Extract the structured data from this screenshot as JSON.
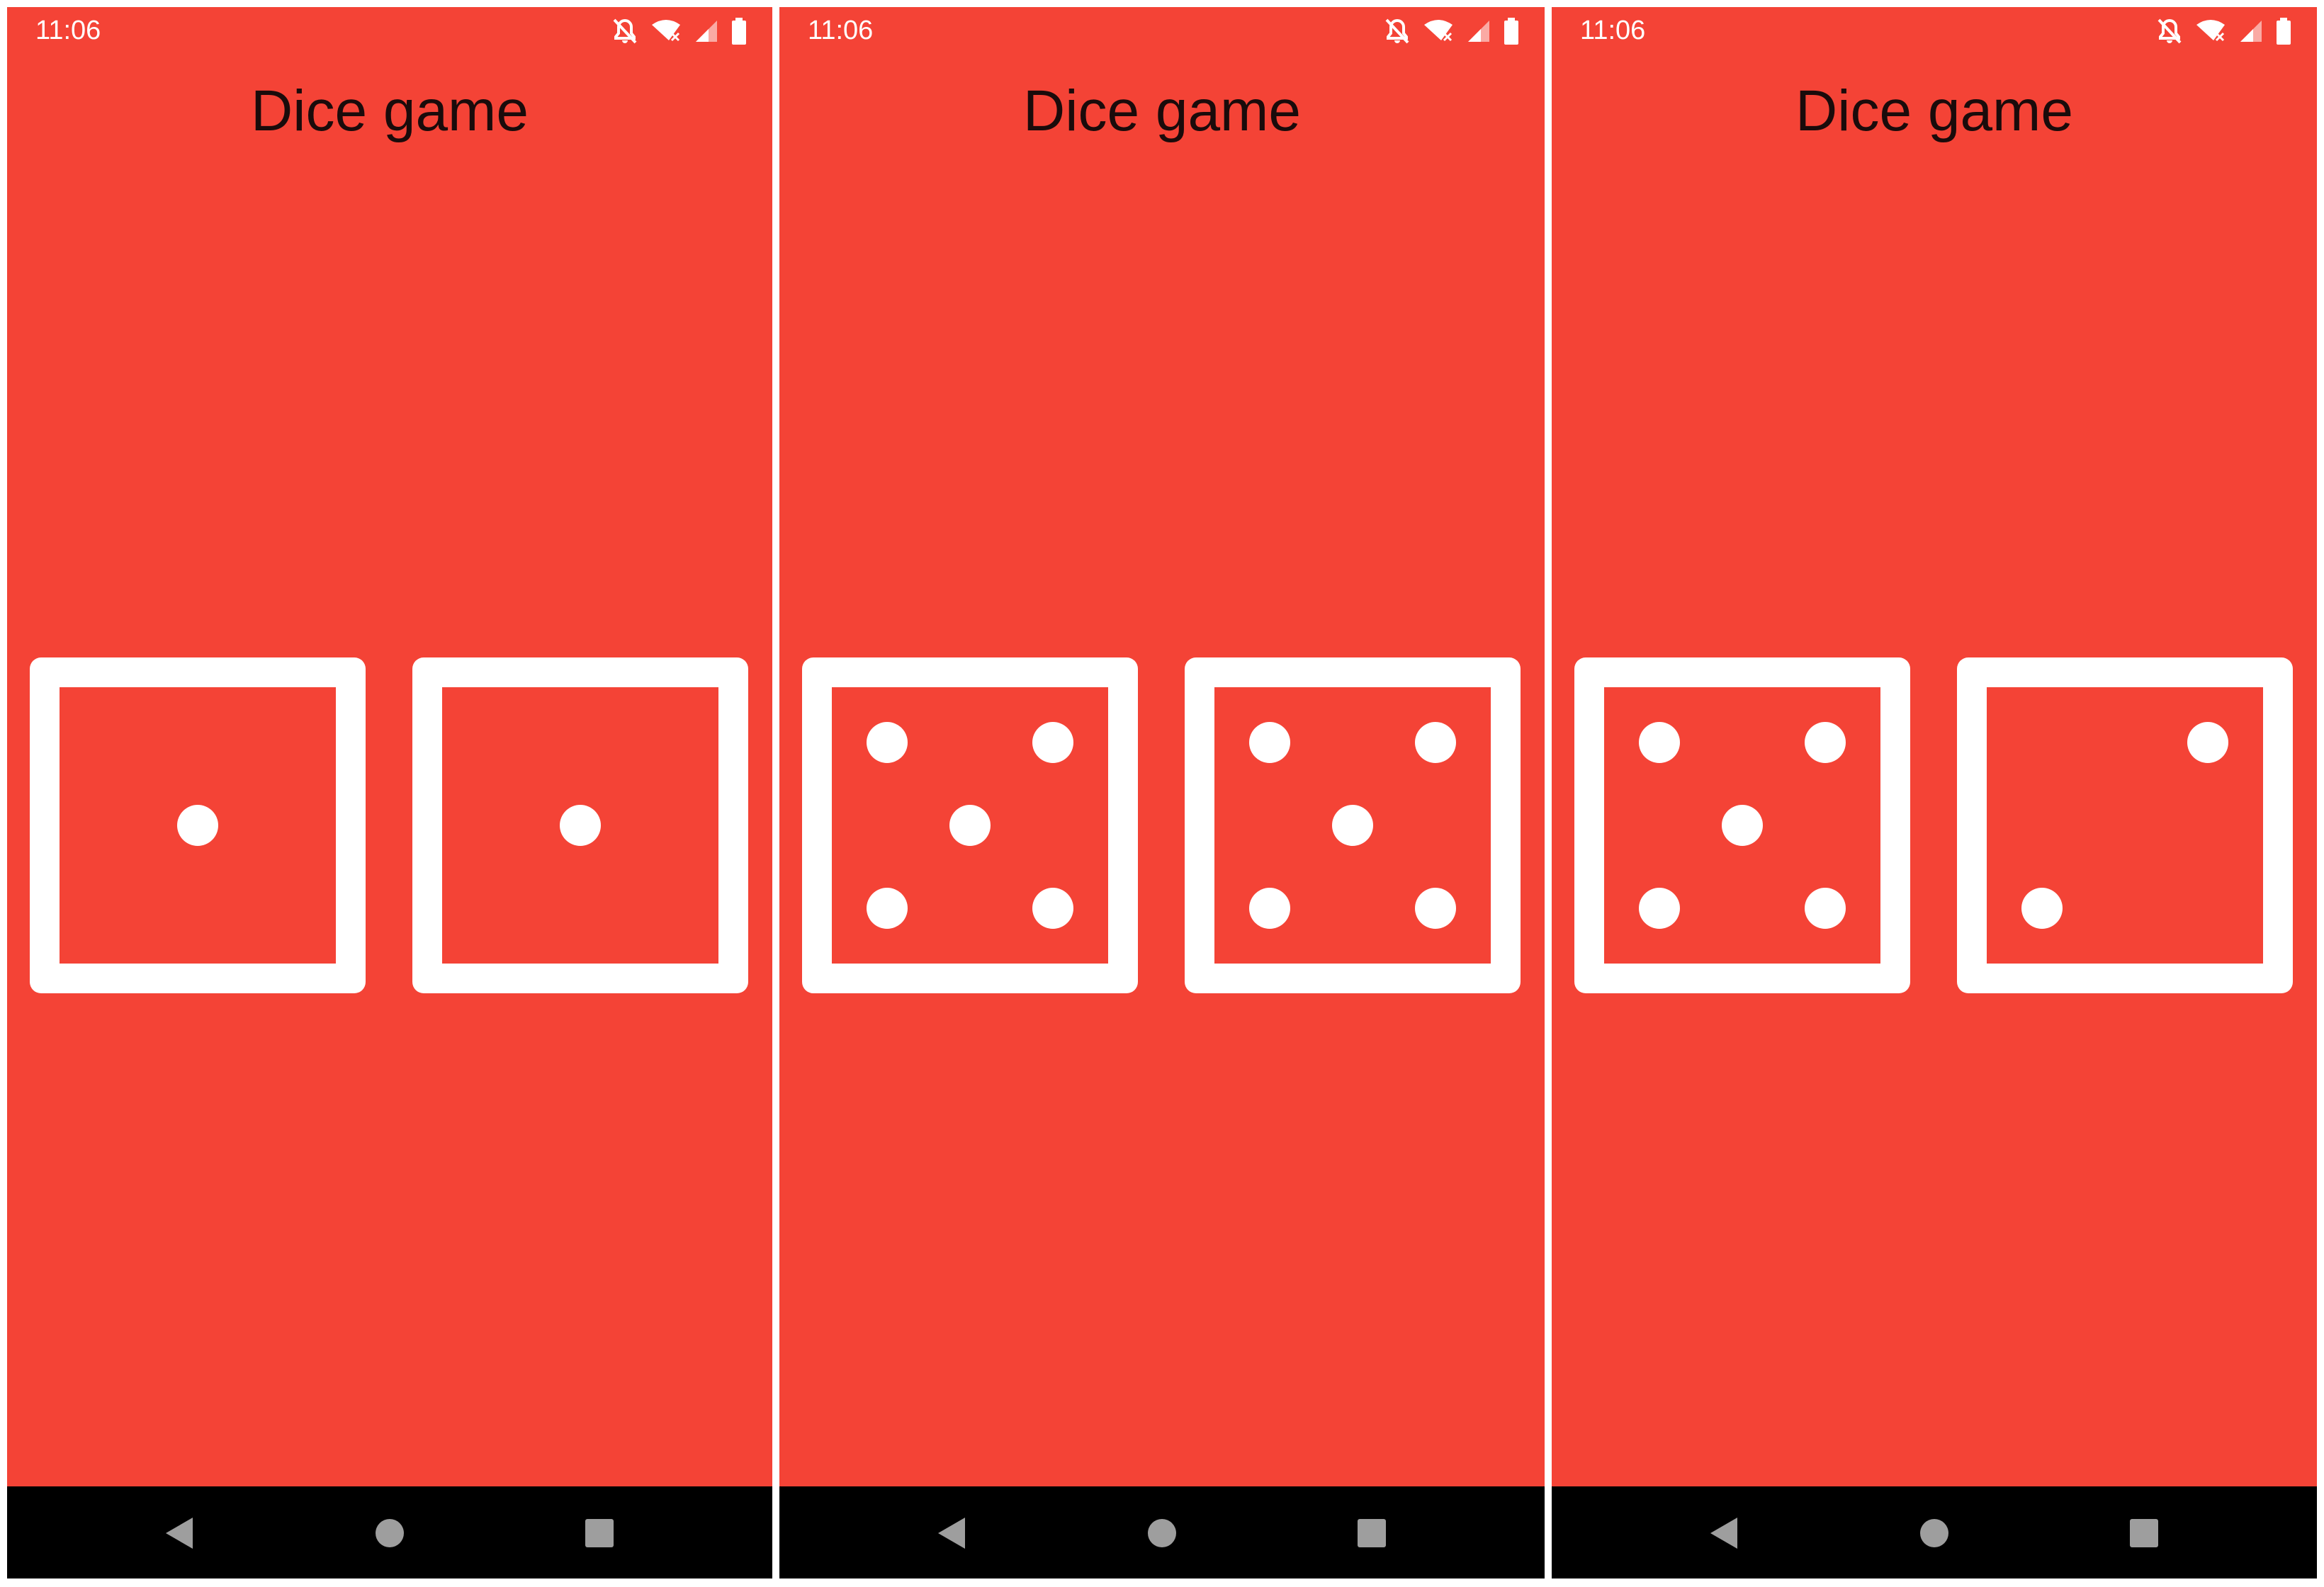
{
  "screens": [
    {
      "status_time": "11:06",
      "title": "Dice game",
      "dice": [
        1,
        1
      ]
    },
    {
      "status_time": "11:06",
      "title": "Dice game",
      "dice": [
        5,
        5
      ]
    },
    {
      "status_time": "11:06",
      "title": "Dice game",
      "dice": [
        5,
        2
      ]
    }
  ],
  "icons": {
    "status": [
      "notifications-off-icon",
      "wifi-off-icon",
      "cell-signal-icon",
      "battery-icon"
    ],
    "nav": [
      "back-icon",
      "home-icon",
      "recents-icon"
    ]
  },
  "colors": {
    "background": "#f44336",
    "die": "#ffffff",
    "title_text": "#1a0b0b",
    "nav_bar": "#000000",
    "nav_icons": "#9e9e9e"
  }
}
